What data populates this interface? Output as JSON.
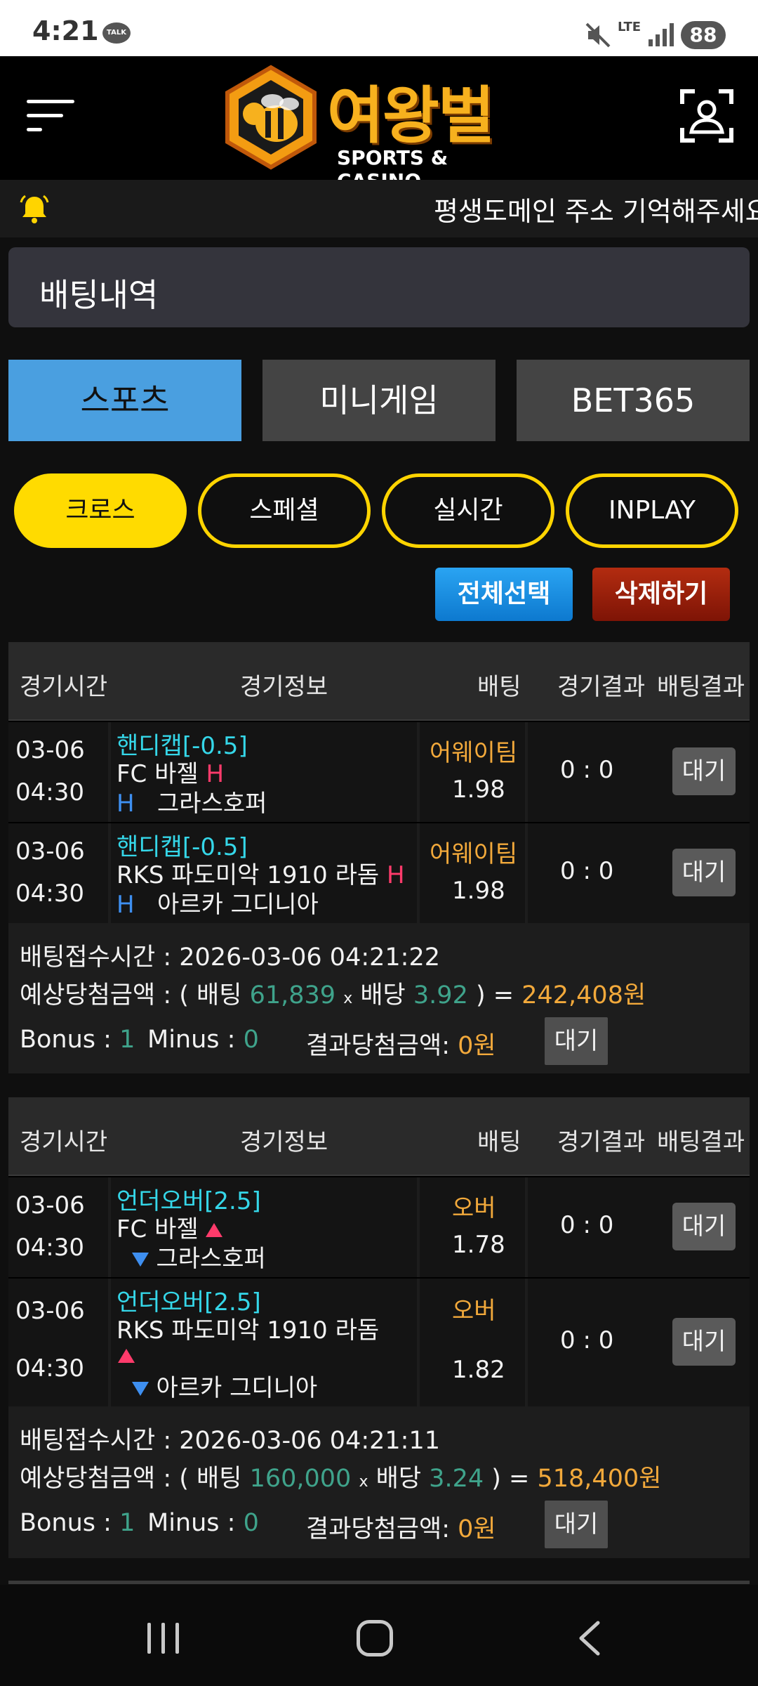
{
  "status_bar": {
    "time": "4:21",
    "talk_label": "TALK",
    "network": "LTE",
    "battery": "88"
  },
  "header": {
    "logo_text": "여왕벌",
    "logo_subtitle": "SPORTS & CASINO"
  },
  "notice": {
    "text": "평생도메인 주소 기억해주세요"
  },
  "page": {
    "title": "배팅내역"
  },
  "tabs": [
    {
      "label": "스포츠",
      "active": true
    },
    {
      "label": "미니게임",
      "active": false
    },
    {
      "label": "BET365",
      "active": false
    }
  ],
  "filters": [
    {
      "label": "크로스",
      "active": true
    },
    {
      "label": "스페셜",
      "active": false
    },
    {
      "label": "실시간",
      "active": false
    },
    {
      "label": "INPLAY",
      "active": false
    }
  ],
  "actions": {
    "select_all": "전체선택",
    "delete": "삭제하기"
  },
  "table_headers": [
    "경기시간",
    "경기정보",
    "배팅",
    "경기결과",
    "배팅결과"
  ],
  "bet_slips": [
    {
      "rows": [
        {
          "date": "03-06",
          "time": "04:30",
          "market": "핸디캡[-0.5]",
          "home": "FC 바젤",
          "home_mark": "H",
          "away_mark": "H",
          "away": "그라스호퍼",
          "pick": "어웨이팀",
          "odds": "1.98",
          "score": "0 : 0",
          "status": "대기"
        },
        {
          "date": "03-06",
          "time": "04:30",
          "market": "핸디캡[-0.5]",
          "home": "RKS 파도미악 1910 라돔",
          "home_mark": "H",
          "away_mark": "H",
          "away": "아르카 그디니아",
          "pick": "어웨이팀",
          "odds": "1.98",
          "score": "0 : 0",
          "status": "대기"
        }
      ],
      "received_label": "배팅접수시간 :",
      "received_time": "2026-03-06 04:21:22",
      "expected_label": "예상당첨금액 : ( 배팅",
      "stake": "61,839",
      "times": "x",
      "odds_label": "배당",
      "total_odds": "3.92",
      "equals": ") =",
      "payout": "242,408원",
      "bonus_label": "Bonus :",
      "bonus": "1",
      "minus_label": "Minus :",
      "minus": "0",
      "result_label": "결과당첨금액:",
      "result_amount": "0원",
      "status": "대기"
    },
    {
      "rows": [
        {
          "date": "03-06",
          "time": "04:30",
          "market": "언더오버[2.5]",
          "home": "FC 바젤",
          "away": "그라스호퍼",
          "pick": "오버",
          "odds": "1.78",
          "score": "0 : 0",
          "status": "대기"
        },
        {
          "date": "03-06",
          "time": "04:30",
          "market": "언더오버[2.5]",
          "home": "RKS 파도미악 1910 라돔",
          "away": "아르카 그디니아",
          "pick": "오버",
          "odds": "1.82",
          "score": "0 : 0",
          "status": "대기"
        }
      ],
      "received_label": "배팅접수시간 :",
      "received_time": "2026-03-06 04:21:11",
      "expected_label": "예상당첨금액 : ( 배팅",
      "stake": "160,000",
      "times": "x",
      "odds_label": "배당",
      "total_odds": "3.24",
      "equals": ") =",
      "payout": "518,400원",
      "bonus_label": "Bonus :",
      "bonus": "1",
      "minus_label": "Minus :",
      "minus": "0",
      "result_label": "결과당첨금액:",
      "result_amount": "0원",
      "status": "대기"
    }
  ],
  "colors": {
    "accent_yellow": "#ffdb00",
    "tab_active": "#4a9fe0",
    "cyan_market": "#35d7e9",
    "orange_pick": "#f2a93b",
    "delete_red": "#9e1e0a",
    "select_blue": "#1a8fe2"
  }
}
